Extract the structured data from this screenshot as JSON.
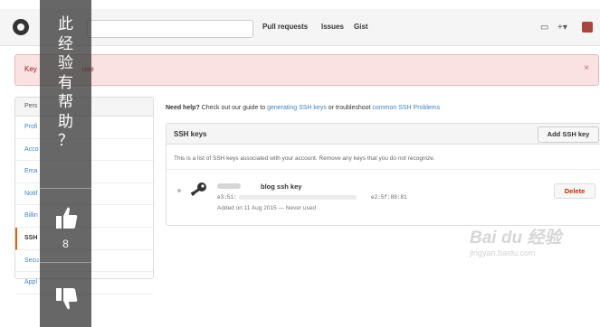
{
  "header": {
    "nav": [
      "Pull requests",
      "Issues",
      "Gist"
    ],
    "icons": [
      "github-logo",
      "notification-icon",
      "plus-icon",
      "avatar"
    ]
  },
  "flash": {
    "text": "Key",
    "text_tail": "use",
    "close": "×"
  },
  "menu": {
    "header": "Pers",
    "items": [
      "Profi",
      "Acco",
      "Ema",
      "Notif",
      "Billin",
      "SSH",
      "Secu",
      "Appl"
    ]
  },
  "help": {
    "lead": "Need help?",
    "text1": " Check out our guide to ",
    "link1": "generating SSH keys",
    "text2": " or troubleshoot ",
    "link2": "common SSH Problems"
  },
  "ssh": {
    "title": "SSH keys",
    "add_button": "Add SSH key",
    "description": "This is a list of SSH keys associated with your account. Remove any keys that you do not recognize.",
    "key_title": "blog ssh key",
    "fingerprint_start": "e3:51:",
    "fingerprint_end": "e2:5f:89:81",
    "added": "Added on 11 Aug 2015 — Never used",
    "delete_button": "Delete"
  },
  "watermark": {
    "logo": "Bai du 经验",
    "sub": "jingyan.baidu.com"
  },
  "feedback": {
    "question": [
      "此",
      "经",
      "验",
      "有",
      "帮",
      "助",
      "？"
    ],
    "helpful_count": "8"
  }
}
